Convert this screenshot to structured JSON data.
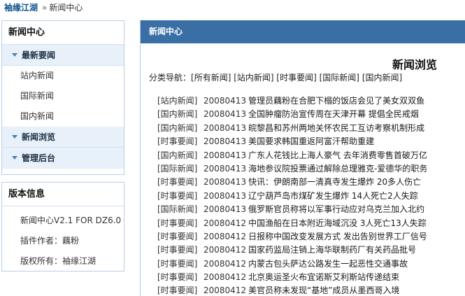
{
  "breadcrumb": {
    "site": "袖缘江湖",
    "separator": "»",
    "current": "新闻中心"
  },
  "sidebar": {
    "nav_title": "新闻中心",
    "groups": [
      {
        "label": "最新要闻",
        "items": [
          "站内新闻",
          "国际新闻",
          "国内新闻"
        ]
      },
      {
        "label": "新闻浏览"
      },
      {
        "label": "管理后台"
      }
    ],
    "info_title": "版本信息",
    "info_items": [
      "新闻中心V2.1 FOR DZ6.0",
      "插件作者：藕粉",
      "版权所有：袖缘江湖"
    ]
  },
  "main": {
    "header": "新闻中心",
    "title": "新闻浏览",
    "catnav_label": "分类导航：",
    "categories": [
      "[所有新闻]",
      "[站内新闻]",
      "[时事要闻]",
      "[国际新闻]",
      "[国内新闻]"
    ],
    "news": [
      {
        "cat": "[站内新闻]",
        "date": "20080413",
        "title": "管理员藕粉在合肥下榻的饭店会见了美女双双鱼"
      },
      {
        "cat": "[国内新闻]",
        "date": "20080413",
        "title": "全国肿瘤防治宣传周在天津开幕 提倡全民戒烟"
      },
      {
        "cat": "[国内新闻]",
        "date": "20080413",
        "title": "皖黎昌和苏州两地关怀农民工互访考察机制形成"
      },
      {
        "cat": "[时事要闻]",
        "date": "20080413",
        "title": "美国要求韩国重返阿富汗帮助重建"
      },
      {
        "cat": "[国内新闻]",
        "date": "20080413",
        "title": "广东人花钱比上海人豪气 去年消费零售首破万亿"
      },
      {
        "cat": "[国际新闻]",
        "date": "20080413",
        "title": "海地参议院投票通过解除总理雅克-爱德华的职务"
      },
      {
        "cat": "[时事要闻]",
        "date": "20080413",
        "title": "快讯：伊朗南部一清真寺发生爆炸 20多人伤亡"
      },
      {
        "cat": "[时事要闻]",
        "date": "20080413",
        "title": "辽宁葫芦岛市煤矿发生爆炸 14人死亡2人失踪"
      },
      {
        "cat": "[国际新闻]",
        "date": "20080413",
        "title": "俄罗斯官员称将以军事行动应对乌克兰加入北约"
      },
      {
        "cat": "[时事要闻]",
        "date": "20080412",
        "title": "中国渔船在日本附近海域沉没 3人死亡13人失踪"
      },
      {
        "cat": "[时事要闻]",
        "date": "20080412",
        "title": "日报称中国改变发展方式 发出告别世界工厂信号"
      },
      {
        "cat": "[时事要闻]",
        "date": "20080412",
        "title": "国家药监局注销上海华联制药厂有关药品批号"
      },
      {
        "cat": "[时事要闻]",
        "date": "20080412",
        "title": "内蒙古包头萨达公路发生一起恶性交通事故"
      },
      {
        "cat": "[时事要闻]",
        "date": "20080412",
        "title": "北京奥运圣火布宜诺斯艾利斯站传递结束"
      },
      {
        "cat": "[时事要闻]",
        "date": "20080412",
        "title": "美官员称未发现“基地”成员从墨西哥入境"
      }
    ]
  }
}
